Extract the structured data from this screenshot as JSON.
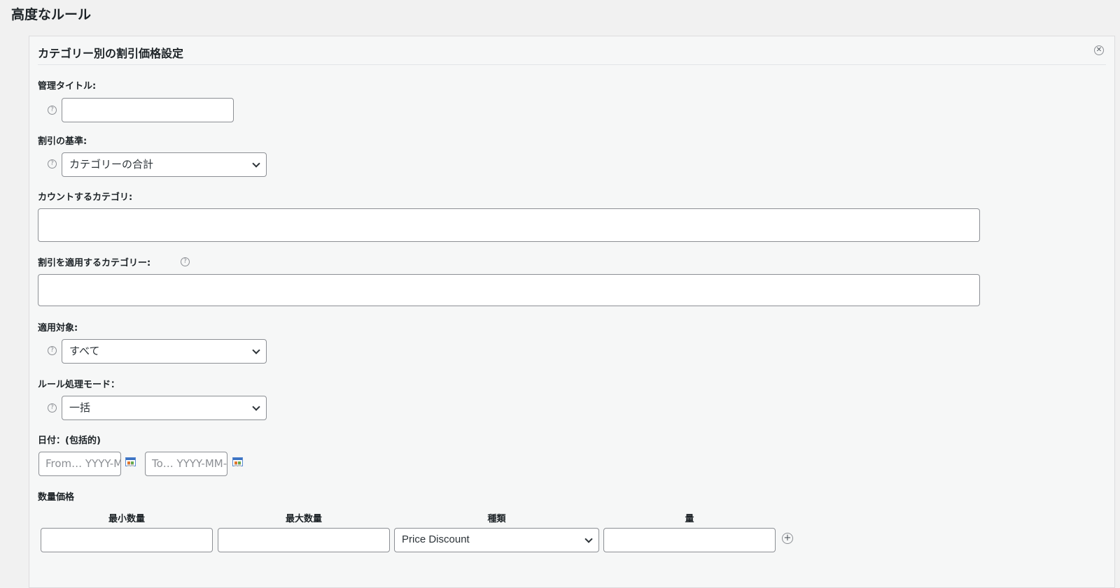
{
  "page": {
    "title": "高度なルール"
  },
  "panel": {
    "title": "カテゴリー別の割引価格設定",
    "admin_title": {
      "label": "管理タイトル:",
      "value": ""
    },
    "discount_basis": {
      "label": "割引の基準:",
      "value": "カテゴリーの合計"
    },
    "count_categories": {
      "label": "カウントするカテゴリ:",
      "value": ""
    },
    "apply_categories": {
      "label": "割引を適用するカテゴリー:",
      "value": ""
    },
    "applies_to": {
      "label": "適用対象:",
      "value": "すべて"
    },
    "processing_mode": {
      "label": "ルール処理モード：",
      "value": "一括"
    },
    "dates": {
      "label": "日付：(包括的)",
      "from_placeholder": "From… YYYY-MM-DD",
      "to_placeholder": "To… YYYY-MM-DD"
    },
    "quantity_pricing": {
      "label": "数量価格",
      "columns": [
        "最小数量",
        "最大数量",
        "種類",
        "量"
      ],
      "row": {
        "min": "",
        "max": "",
        "type": "Price Discount",
        "amount": ""
      }
    }
  },
  "icons": [
    "close-icon",
    "help-icon",
    "calendar-icon",
    "chevron-down-icon",
    "plus-icon"
  ]
}
